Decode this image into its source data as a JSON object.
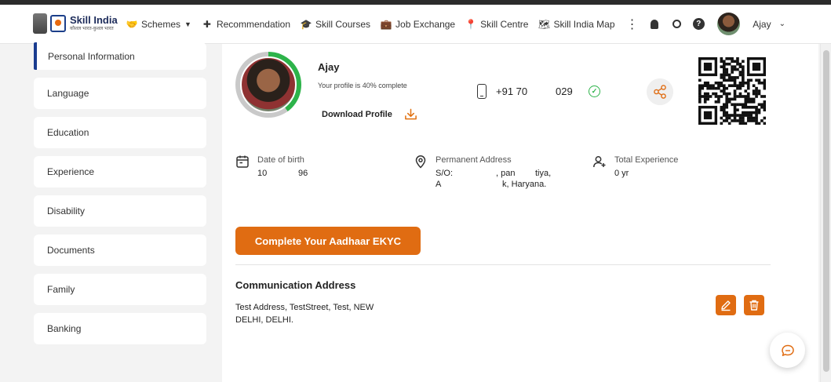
{
  "app": {
    "logo_title": "Skill India",
    "logo_subtitle": "कौशल भारत-कुशल भारत"
  },
  "nav": {
    "items": [
      {
        "label": "Schemes",
        "icon": "handshake-icon",
        "has_dropdown": true
      },
      {
        "label": "Recommendation",
        "icon": "plus-chat-icon"
      },
      {
        "label": "Skill Courses",
        "icon": "graduation-cap-icon"
      },
      {
        "label": "Job Exchange",
        "icon": "briefcase-icon"
      },
      {
        "label": "Skill Centre",
        "icon": "location-pin-icon"
      },
      {
        "label": "Skill India Map",
        "icon": "india-map-icon"
      }
    ],
    "more_icon": "⋮"
  },
  "user": {
    "name": "Ajay"
  },
  "sidebar": {
    "items": [
      {
        "label": "Personal Information",
        "active": true
      },
      {
        "label": "Language"
      },
      {
        "label": "Education"
      },
      {
        "label": "Experience"
      },
      {
        "label": "Disability"
      },
      {
        "label": "Documents"
      },
      {
        "label": "Family"
      },
      {
        "label": "Banking"
      }
    ]
  },
  "profile": {
    "name": "Ajay",
    "completion_text": "Your profile is 40% complete",
    "completion_percent": 40,
    "download_label": "Download Profile",
    "phone_prefix": "+91 70",
    "phone_suffix": "029",
    "date_of_birth_label": "Date of birth",
    "date_of_birth_value_a": "10",
    "date_of_birth_value_b": "96",
    "address_label": "Permanent Address",
    "address_line1_a": "S/O:",
    "address_line1_b": ", pan",
    "address_line1_c": "tiya,",
    "address_line2_a": "A",
    "address_line2_b": "k, Haryana.",
    "experience_label": "Total Experience",
    "experience_value": "0 yr"
  },
  "ekyc_button": "Complete Your Aadhaar EKYC",
  "communication": {
    "title": "Communication Address",
    "address": "Test Address, TestStreet, Test, NEW DELHI, DELHI."
  },
  "colors": {
    "accent": "#e06c12",
    "progress": "#2db34a",
    "active_border": "#1a3c8f"
  }
}
